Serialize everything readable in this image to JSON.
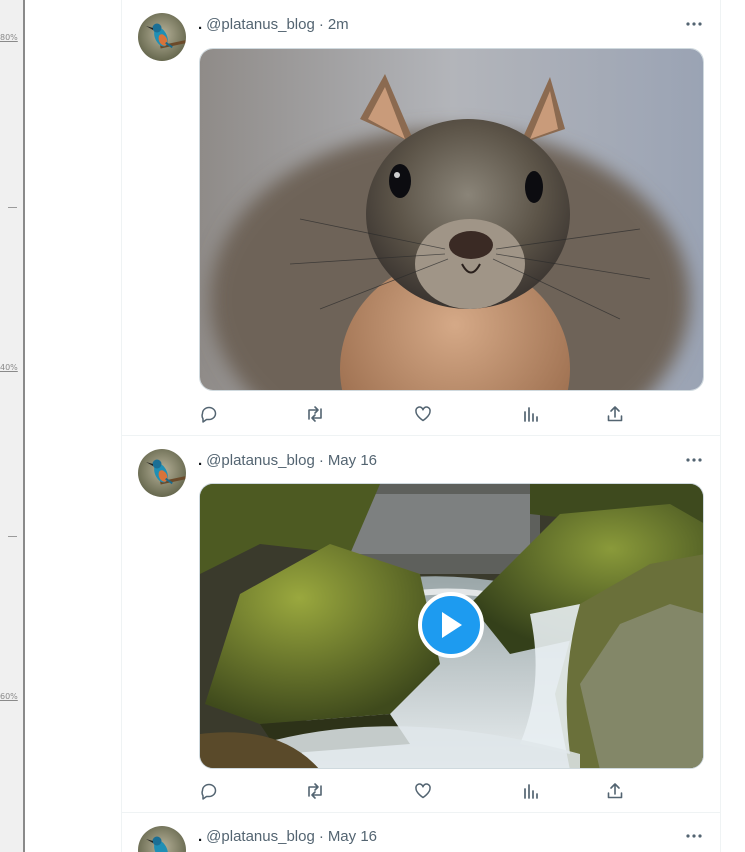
{
  "ruler": {
    "labels": [
      "80%",
      "40%",
      "60%"
    ]
  },
  "posts": [
    {
      "prefix": ".",
      "handle": "@platanus_blog",
      "separator": "·",
      "time": "2m",
      "media_type": "image",
      "media_subject": "squirrel"
    },
    {
      "prefix": ".",
      "handle": "@platanus_blog",
      "separator": "·",
      "time": "May 16",
      "media_type": "video",
      "media_subject": "waterfall"
    },
    {
      "prefix": ".",
      "handle": "@platanus_blog",
      "separator": "·",
      "time": "May 16",
      "media_type": "image",
      "media_subject": ""
    }
  ],
  "icons": {
    "avatar": "kingfisher-avatar-icon",
    "more": "more-options-icon",
    "reply": "reply-icon",
    "repost": "repost-icon",
    "like": "like-icon",
    "views": "views-icon",
    "share": "share-icon",
    "play": "play-icon"
  },
  "colors": {
    "accent": "#1d9bf0",
    "text_secondary": "#536471",
    "border": "#eff3f4"
  }
}
